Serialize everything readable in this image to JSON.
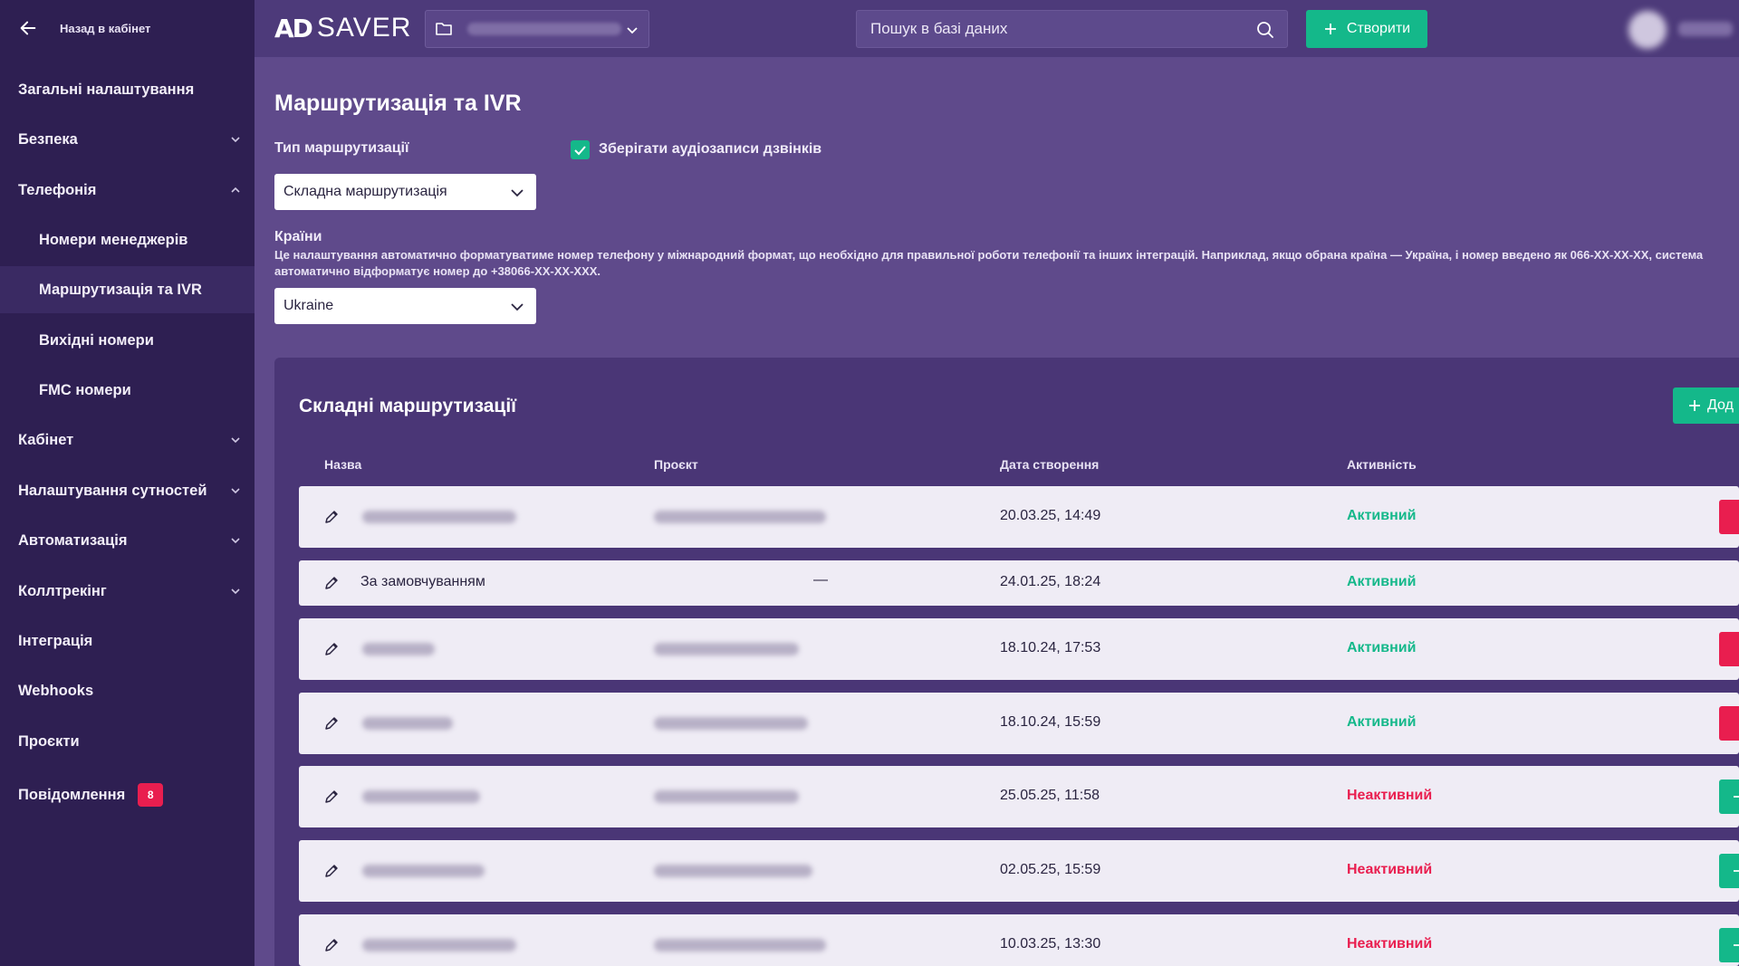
{
  "sidebar": {
    "back_label": "Назад в кабінет",
    "items": [
      {
        "label": "Загальні налаштування"
      },
      {
        "label": "Безпека"
      },
      {
        "label": "Телефонія"
      },
      {
        "label": "Номери менеджерів"
      },
      {
        "label": "Маршрутизація та IVR"
      },
      {
        "label": "Вихідні номери"
      },
      {
        "label": "FMC номери"
      },
      {
        "label": "Кабінет"
      },
      {
        "label": "Налаштування сутностей"
      },
      {
        "label": "Автоматизація"
      },
      {
        "label": "Коллтрекінг"
      },
      {
        "label": "Інтеграція"
      },
      {
        "label": "Webhooks"
      },
      {
        "label": "Проєкти"
      },
      {
        "label": "Повідомлення",
        "badge": "8"
      }
    ]
  },
  "header": {
    "logo_mark": "AD",
    "logo_text": "SAVER",
    "search_placeholder": "Пошук в базі даних",
    "create_label": "Створити"
  },
  "main": {
    "title": "Маршрутизація та IVR",
    "routing_type_label": "Тип маршрутизації",
    "routing_type_value": "Складна маршрутизація",
    "save_recordings_label": "Зберігати аудіозаписи дзвінків",
    "countries_label": "Країни",
    "countries_hint": "Це налаштування автоматично форматуватиме номер телефону у міжнародний формат, що необхідно для правильної роботи телефонії та інших інтеграцій. Наприклад, якщо обрана країна — Україна, і номер введено як 066-XX-XX-XX, система автоматично відформатує номер до +38066-XX-XX-XXX.",
    "country_value": "Ukraine"
  },
  "table": {
    "title": "Складні маршрутизації",
    "add_label": "Дод",
    "columns": [
      "Назва",
      "Проєкт",
      "Дата створення",
      "Активність"
    ],
    "rows": [
      {
        "name": "",
        "project": "",
        "date": "20.03.25, 14:49",
        "status": "Активний"
      },
      {
        "name": "За замовчуванням",
        "project": "—",
        "date": "24.01.25, 18:24",
        "status": "Активний"
      },
      {
        "name": "",
        "project": "",
        "date": "18.10.24, 17:53",
        "status": "Активний"
      },
      {
        "name": "",
        "project": "",
        "date": "18.10.24, 15:59",
        "status": "Активний"
      },
      {
        "name": "",
        "project": "",
        "date": "25.05.25, 11:58",
        "status": "Неактивний"
      },
      {
        "name": "",
        "project": "",
        "date": "02.05.25, 15:59",
        "status": "Неактивний"
      },
      {
        "name": "",
        "project": "",
        "date": "10.03.25, 13:30",
        "status": "Неактивний"
      }
    ]
  },
  "colors": {
    "sidebar_bg": "#2e1f52",
    "content_bg": "#5f4a8b",
    "accent_green": "#14b88a",
    "accent_red": "#e91e4f"
  }
}
